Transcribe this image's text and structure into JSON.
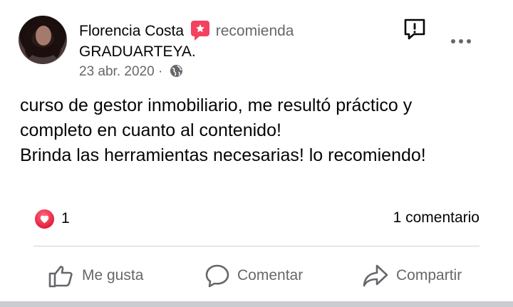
{
  "post": {
    "author_name": "Florencia Costa",
    "recommends_text": "recomienda",
    "page_name": "GRADUARTEYA",
    "page_suffix": ".",
    "date": "23 abr. 2020",
    "date_separator": "·",
    "privacy_icon": "globe-icon",
    "text_lines": [
      "curso de gestor inmobiliario, me resultó práctico y",
      "completo en cuanto al contenido!",
      "Brinda las herramientas necesarias! lo recomiendo!"
    ]
  },
  "stats": {
    "reaction_icon": "love-icon",
    "reaction_count": "1",
    "comments": "1 comentario"
  },
  "actions": {
    "like": "Me gusta",
    "comment": "Comentar",
    "share": "Compartir"
  },
  "colors": {
    "badge": "#f3425f",
    "love": "#e41e3f",
    "secondary_text": "#65676b"
  }
}
